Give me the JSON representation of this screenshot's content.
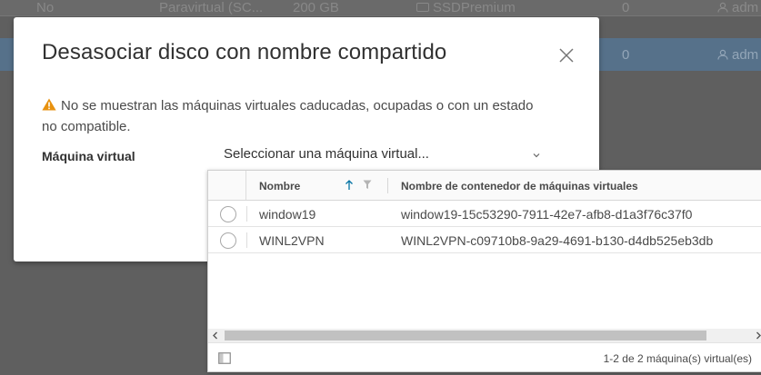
{
  "background_table": {
    "row1": {
      "shared": "No",
      "type": "Paravirtual (SC...",
      "size": "200 GB",
      "sku": "SSDPremium",
      "lun": "0",
      "owner": "adm"
    },
    "row2": {
      "lun": "0",
      "owner": "adm"
    }
  },
  "modal": {
    "title": "Desasociar disco con nombre compartido",
    "close_icon": "close-icon",
    "warning_text": "No se muestran las máquinas virtuales caducadas, ocupadas o con un estado no compatible.",
    "warning_icon": "warning-triangle-icon",
    "warning_color": "#e8920f",
    "field_label": "Máquina virtual",
    "select_placeholder": "Seleccionar una máquina virtual..."
  },
  "grid": {
    "columns": {
      "name": "Nombre",
      "container": "Nombre de contenedor de máquinas virtuales"
    },
    "rows": [
      {
        "name": "window19",
        "container": "window19-15c53290-7911-42e7-afb8-d1a3f76c37f0"
      },
      {
        "name": "WINL2VPN",
        "container": "WINL2VPN-c09710b8-9a29-4691-b130-d4db525eb3db"
      }
    ],
    "footer_count": "1-2 de 2 máquina(s) virtual(es)",
    "accent_color": "#0072a3"
  }
}
